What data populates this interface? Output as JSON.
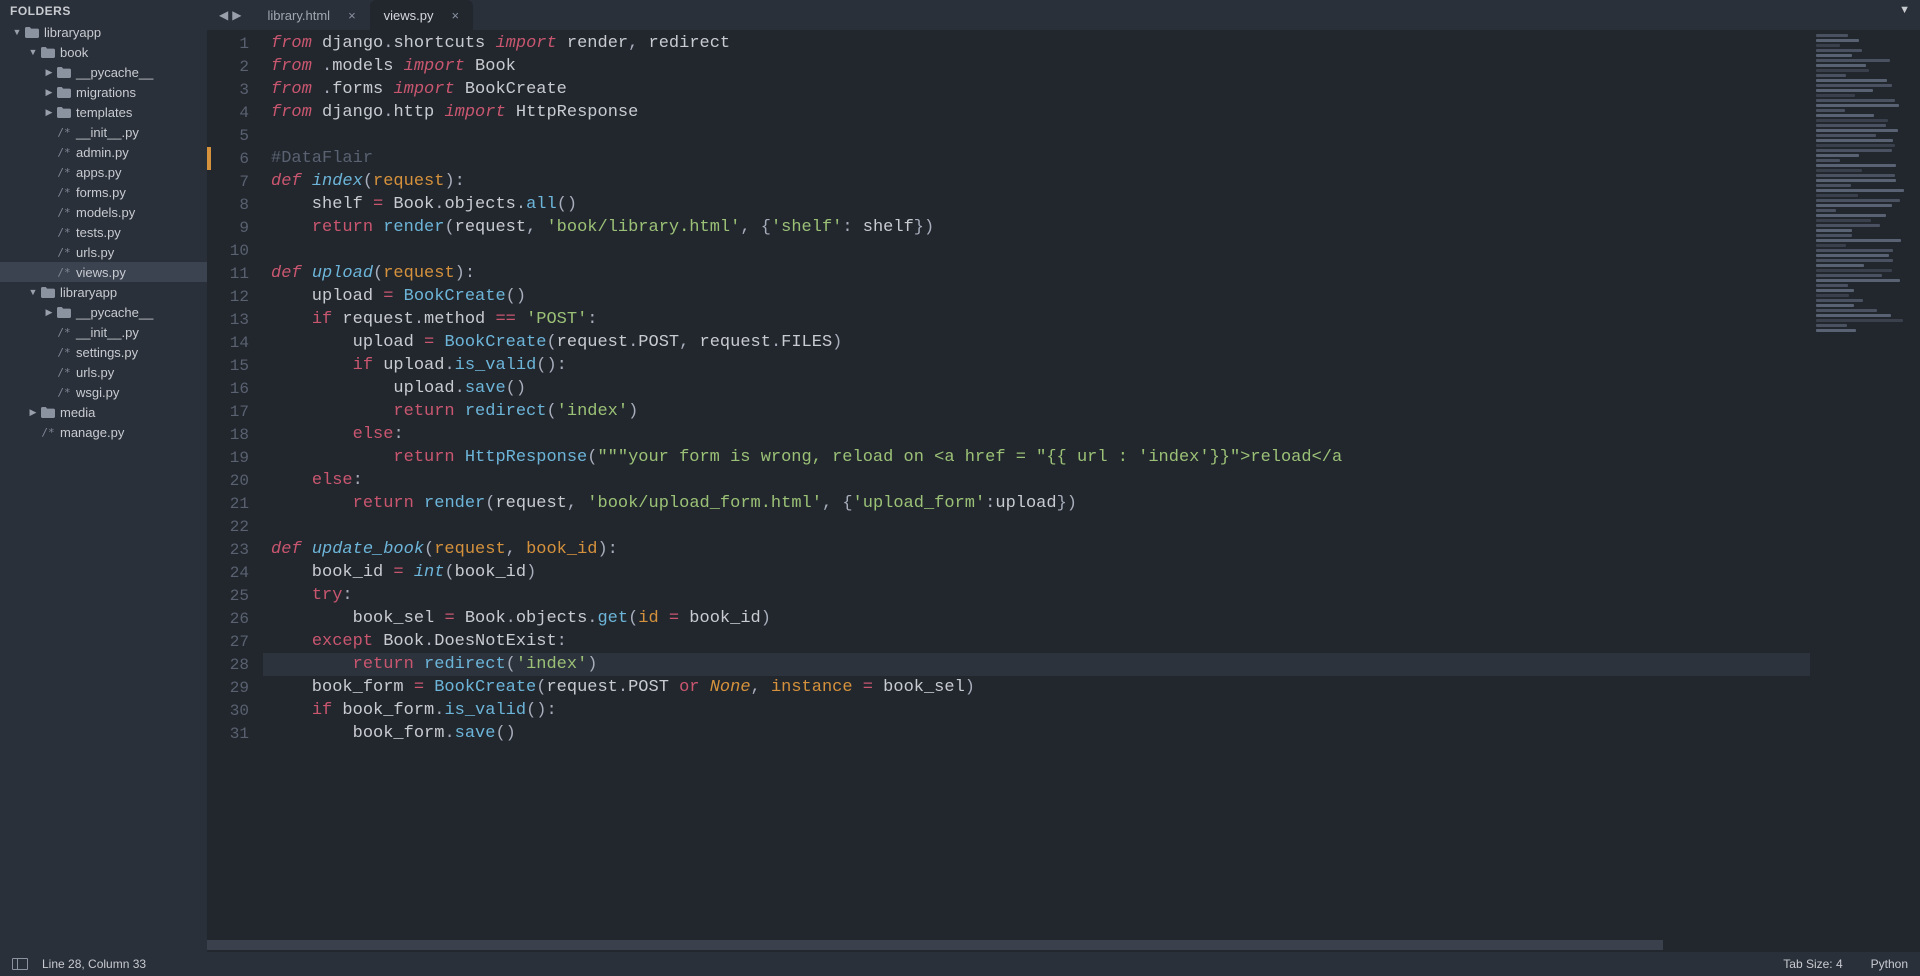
{
  "sidebar": {
    "header": "FOLDERS",
    "tree": [
      {
        "t": "folder",
        "name": "libraryapp",
        "depth": 0,
        "expanded": true
      },
      {
        "t": "folder",
        "name": "book",
        "depth": 1,
        "expanded": true
      },
      {
        "t": "folder",
        "name": "__pycache__",
        "depth": 2,
        "expanded": false
      },
      {
        "t": "folder",
        "name": "migrations",
        "depth": 2,
        "expanded": false
      },
      {
        "t": "folder",
        "name": "templates",
        "depth": 2,
        "expanded": false
      },
      {
        "t": "file",
        "name": "__init__.py",
        "depth": 2
      },
      {
        "t": "file",
        "name": "admin.py",
        "depth": 2
      },
      {
        "t": "file",
        "name": "apps.py",
        "depth": 2
      },
      {
        "t": "file",
        "name": "forms.py",
        "depth": 2
      },
      {
        "t": "file",
        "name": "models.py",
        "depth": 2
      },
      {
        "t": "file",
        "name": "tests.py",
        "depth": 2
      },
      {
        "t": "file",
        "name": "urls.py",
        "depth": 2
      },
      {
        "t": "file",
        "name": "views.py",
        "depth": 2,
        "selected": true
      },
      {
        "t": "folder",
        "name": "libraryapp",
        "depth": 1,
        "expanded": true
      },
      {
        "t": "folder",
        "name": "__pycache__",
        "depth": 2,
        "expanded": false
      },
      {
        "t": "file",
        "name": "__init__.py",
        "depth": 2
      },
      {
        "t": "file",
        "name": "settings.py",
        "depth": 2
      },
      {
        "t": "file",
        "name": "urls.py",
        "depth": 2
      },
      {
        "t": "file",
        "name": "wsgi.py",
        "depth": 2
      },
      {
        "t": "folder",
        "name": "media",
        "depth": 1,
        "expanded": false
      },
      {
        "t": "file",
        "name": "manage.py",
        "depth": 1
      }
    ]
  },
  "tabs": [
    {
      "name": "library.html",
      "active": false
    },
    {
      "name": "views.py",
      "active": true
    }
  ],
  "code": {
    "highlighted_line": 28,
    "modified_line": 6,
    "lines": [
      {
        "n": 1,
        "tokens": [
          [
            "k-red",
            "from"
          ],
          [
            "k-plain",
            " django"
          ],
          [
            "k-punc",
            "."
          ],
          [
            "k-plain",
            "shortcuts "
          ],
          [
            "k-red",
            "import"
          ],
          [
            "k-plain",
            " render"
          ],
          [
            "k-punc",
            ", "
          ],
          [
            "k-plain",
            "redirect"
          ]
        ]
      },
      {
        "n": 2,
        "tokens": [
          [
            "k-red",
            "from"
          ],
          [
            "k-plain",
            " "
          ],
          [
            "k-punc",
            "."
          ],
          [
            "k-plain",
            "models "
          ],
          [
            "k-red",
            "import"
          ],
          [
            "k-plain",
            " Book"
          ]
        ]
      },
      {
        "n": 3,
        "tokens": [
          [
            "k-red",
            "from"
          ],
          [
            "k-plain",
            " "
          ],
          [
            "k-punc",
            "."
          ],
          [
            "k-plain",
            "forms "
          ],
          [
            "k-red",
            "import"
          ],
          [
            "k-plain",
            " BookCreate"
          ]
        ]
      },
      {
        "n": 4,
        "tokens": [
          [
            "k-red",
            "from"
          ],
          [
            "k-plain",
            " django"
          ],
          [
            "k-punc",
            "."
          ],
          [
            "k-plain",
            "http "
          ],
          [
            "k-red",
            "import"
          ],
          [
            "k-plain",
            " HttpResponse"
          ]
        ]
      },
      {
        "n": 5,
        "tokens": []
      },
      {
        "n": 6,
        "tokens": [
          [
            "k-cmt",
            "#DataFlair"
          ]
        ]
      },
      {
        "n": 7,
        "tokens": [
          [
            "k-red",
            "def"
          ],
          [
            "k-plain",
            " "
          ],
          [
            "k-blue",
            "index"
          ],
          [
            "k-punc",
            "("
          ],
          [
            "k-orange",
            "request"
          ],
          [
            "k-punc",
            "):"
          ]
        ]
      },
      {
        "n": 8,
        "tokens": [
          [
            "k-plain",
            "    shelf "
          ],
          [
            "k-op",
            "="
          ],
          [
            "k-plain",
            " Book"
          ],
          [
            "k-punc",
            "."
          ],
          [
            "k-plain",
            "objects"
          ],
          [
            "k-punc",
            "."
          ],
          [
            "k-blue-n",
            "all"
          ],
          [
            "k-punc",
            "()"
          ]
        ]
      },
      {
        "n": 9,
        "tokens": [
          [
            "k-plain",
            "    "
          ],
          [
            "k-red-n",
            "return"
          ],
          [
            "k-plain",
            " "
          ],
          [
            "k-blue-n",
            "render"
          ],
          [
            "k-punc",
            "("
          ],
          [
            "k-plain",
            "request"
          ],
          [
            "k-punc",
            ", "
          ],
          [
            "k-str",
            "'book/library.html'"
          ],
          [
            "k-punc",
            ", {"
          ],
          [
            "k-str",
            "'shelf'"
          ],
          [
            "k-punc",
            ": "
          ],
          [
            "k-plain",
            "shelf"
          ],
          [
            "k-punc",
            "})"
          ]
        ]
      },
      {
        "n": 10,
        "tokens": []
      },
      {
        "n": 11,
        "tokens": [
          [
            "k-red",
            "def"
          ],
          [
            "k-plain",
            " "
          ],
          [
            "k-blue",
            "upload"
          ],
          [
            "k-punc",
            "("
          ],
          [
            "k-orange",
            "request"
          ],
          [
            "k-punc",
            "):"
          ]
        ]
      },
      {
        "n": 12,
        "tokens": [
          [
            "k-plain",
            "    upload "
          ],
          [
            "k-op",
            "="
          ],
          [
            "k-plain",
            " "
          ],
          [
            "k-blue-n",
            "BookCreate"
          ],
          [
            "k-punc",
            "()"
          ]
        ]
      },
      {
        "n": 13,
        "tokens": [
          [
            "k-plain",
            "    "
          ],
          [
            "k-red-n",
            "if"
          ],
          [
            "k-plain",
            " request"
          ],
          [
            "k-punc",
            "."
          ],
          [
            "k-plain",
            "method "
          ],
          [
            "k-op",
            "=="
          ],
          [
            "k-plain",
            " "
          ],
          [
            "k-str",
            "'POST'"
          ],
          [
            "k-punc",
            ":"
          ]
        ]
      },
      {
        "n": 14,
        "tokens": [
          [
            "k-plain",
            "        upload "
          ],
          [
            "k-op",
            "="
          ],
          [
            "k-plain",
            " "
          ],
          [
            "k-blue-n",
            "BookCreate"
          ],
          [
            "k-punc",
            "("
          ],
          [
            "k-plain",
            "request"
          ],
          [
            "k-punc",
            "."
          ],
          [
            "k-plain",
            "POST"
          ],
          [
            "k-punc",
            ", "
          ],
          [
            "k-plain",
            "request"
          ],
          [
            "k-punc",
            "."
          ],
          [
            "k-plain",
            "FILES"
          ],
          [
            "k-punc",
            ")"
          ]
        ]
      },
      {
        "n": 15,
        "tokens": [
          [
            "k-plain",
            "        "
          ],
          [
            "k-red-n",
            "if"
          ],
          [
            "k-plain",
            " upload"
          ],
          [
            "k-punc",
            "."
          ],
          [
            "k-blue-n",
            "is_valid"
          ],
          [
            "k-punc",
            "():"
          ]
        ]
      },
      {
        "n": 16,
        "tokens": [
          [
            "k-plain",
            "            upload"
          ],
          [
            "k-punc",
            "."
          ],
          [
            "k-blue-n",
            "save"
          ],
          [
            "k-punc",
            "()"
          ]
        ]
      },
      {
        "n": 17,
        "tokens": [
          [
            "k-plain",
            "            "
          ],
          [
            "k-red-n",
            "return"
          ],
          [
            "k-plain",
            " "
          ],
          [
            "k-blue-n",
            "redirect"
          ],
          [
            "k-punc",
            "("
          ],
          [
            "k-str",
            "'index'"
          ],
          [
            "k-punc",
            ")"
          ]
        ]
      },
      {
        "n": 18,
        "tokens": [
          [
            "k-plain",
            "        "
          ],
          [
            "k-red-n",
            "else"
          ],
          [
            "k-punc",
            ":"
          ]
        ]
      },
      {
        "n": 19,
        "tokens": [
          [
            "k-plain",
            "            "
          ],
          [
            "k-red-n",
            "return"
          ],
          [
            "k-plain",
            " "
          ],
          [
            "k-blue-n",
            "HttpResponse"
          ],
          [
            "k-punc",
            "("
          ],
          [
            "k-str",
            "\"\"\"your form is wrong, reload on <a href = \"{{ url : 'index'}}\">reload</a"
          ]
        ]
      },
      {
        "n": 20,
        "tokens": [
          [
            "k-plain",
            "    "
          ],
          [
            "k-red-n",
            "else"
          ],
          [
            "k-punc",
            ":"
          ]
        ]
      },
      {
        "n": 21,
        "tokens": [
          [
            "k-plain",
            "        "
          ],
          [
            "k-red-n",
            "return"
          ],
          [
            "k-plain",
            " "
          ],
          [
            "k-blue-n",
            "render"
          ],
          [
            "k-punc",
            "("
          ],
          [
            "k-plain",
            "request"
          ],
          [
            "k-punc",
            ", "
          ],
          [
            "k-str",
            "'book/upload_form.html'"
          ],
          [
            "k-punc",
            ", {"
          ],
          [
            "k-str",
            "'upload_form'"
          ],
          [
            "k-punc",
            ":"
          ],
          [
            "k-plain",
            "upload"
          ],
          [
            "k-punc",
            "})"
          ]
        ]
      },
      {
        "n": 22,
        "tokens": []
      },
      {
        "n": 23,
        "tokens": [
          [
            "k-red",
            "def"
          ],
          [
            "k-plain",
            " "
          ],
          [
            "k-blue",
            "update_book"
          ],
          [
            "k-punc",
            "("
          ],
          [
            "k-orange",
            "request"
          ],
          [
            "k-punc",
            ", "
          ],
          [
            "k-orange",
            "book_id"
          ],
          [
            "k-punc",
            "):"
          ]
        ]
      },
      {
        "n": 24,
        "tokens": [
          [
            "k-plain",
            "    book_id "
          ],
          [
            "k-op",
            "="
          ],
          [
            "k-plain",
            " "
          ],
          [
            "k-blue",
            "int"
          ],
          [
            "k-punc",
            "("
          ],
          [
            "k-plain",
            "book_id"
          ],
          [
            "k-punc",
            ")"
          ]
        ]
      },
      {
        "n": 25,
        "tokens": [
          [
            "k-plain",
            "    "
          ],
          [
            "k-red-n",
            "try"
          ],
          [
            "k-punc",
            ":"
          ]
        ]
      },
      {
        "n": 26,
        "tokens": [
          [
            "k-plain",
            "        book_sel "
          ],
          [
            "k-op",
            "="
          ],
          [
            "k-plain",
            " Book"
          ],
          [
            "k-punc",
            "."
          ],
          [
            "k-plain",
            "objects"
          ],
          [
            "k-punc",
            "."
          ],
          [
            "k-blue-n",
            "get"
          ],
          [
            "k-punc",
            "("
          ],
          [
            "k-orange",
            "id"
          ],
          [
            "k-plain",
            " "
          ],
          [
            "k-op",
            "="
          ],
          [
            "k-plain",
            " book_id"
          ],
          [
            "k-punc",
            ")"
          ]
        ]
      },
      {
        "n": 27,
        "tokens": [
          [
            "k-plain",
            "    "
          ],
          [
            "k-red-n",
            "except"
          ],
          [
            "k-plain",
            " Book"
          ],
          [
            "k-punc",
            "."
          ],
          [
            "k-plain",
            "DoesNotExist"
          ],
          [
            "k-punc",
            ":"
          ]
        ]
      },
      {
        "n": 28,
        "tokens": [
          [
            "k-plain",
            "        "
          ],
          [
            "k-red-n",
            "return"
          ],
          [
            "k-plain",
            " "
          ],
          [
            "k-blue-n",
            "redirect"
          ],
          [
            "k-punc",
            "("
          ],
          [
            "k-str",
            "'index'"
          ],
          [
            "k-punc",
            ")"
          ]
        ]
      },
      {
        "n": 29,
        "tokens": [
          [
            "k-plain",
            "    book_form "
          ],
          [
            "k-op",
            "="
          ],
          [
            "k-plain",
            " "
          ],
          [
            "k-blue-n",
            "BookCreate"
          ],
          [
            "k-punc",
            "("
          ],
          [
            "k-plain",
            "request"
          ],
          [
            "k-punc",
            "."
          ],
          [
            "k-plain",
            "POST "
          ],
          [
            "k-op",
            "or"
          ],
          [
            "k-plain",
            " "
          ],
          [
            "k-const",
            "None"
          ],
          [
            "k-punc",
            ", "
          ],
          [
            "k-orange",
            "instance"
          ],
          [
            "k-plain",
            " "
          ],
          [
            "k-op",
            "="
          ],
          [
            "k-plain",
            " book_sel"
          ],
          [
            "k-punc",
            ")"
          ]
        ]
      },
      {
        "n": 30,
        "tokens": [
          [
            "k-plain",
            "    "
          ],
          [
            "k-red-n",
            "if"
          ],
          [
            "k-plain",
            " book_form"
          ],
          [
            "k-punc",
            "."
          ],
          [
            "k-blue-n",
            "is_valid"
          ],
          [
            "k-punc",
            "():"
          ]
        ]
      },
      {
        "n": 31,
        "tokens": [
          [
            "k-plain",
            "        book_form"
          ],
          [
            "k-punc",
            "."
          ],
          [
            "k-blue-n",
            "save"
          ],
          [
            "k-punc",
            "()"
          ]
        ]
      }
    ]
  },
  "status": {
    "cursor": "Line 28, Column 33",
    "tabsize": "Tab Size: 4",
    "syntax": "Python"
  }
}
